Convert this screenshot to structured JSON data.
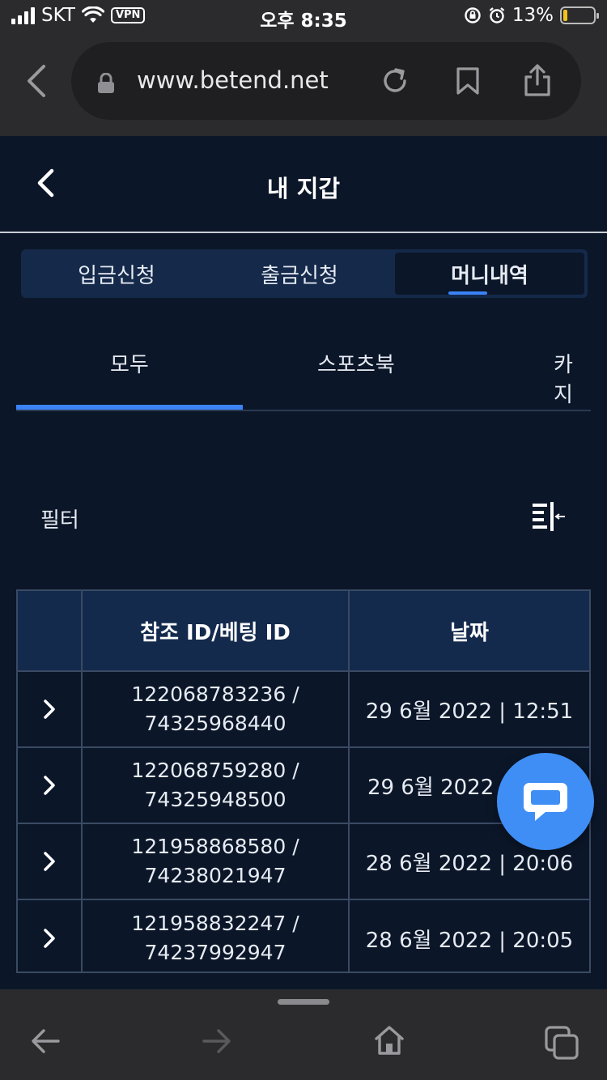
{
  "status_bar": {
    "carrier": "SKT",
    "vpn": "VPN",
    "time": "오후 8:35",
    "battery": "13%",
    "battery_level": 0.13
  },
  "browser": {
    "url": "www.betend.net"
  },
  "header": {
    "title": "내 지갑"
  },
  "segment_tabs": [
    "입금신청",
    "출금신청",
    "머니내역"
  ],
  "segment_active_index": 2,
  "sub_tabs": [
    "모두",
    "스포츠북",
    "카지"
  ],
  "sub_tab_active_index": 0,
  "filter": {
    "label": "필터"
  },
  "table": {
    "headers": [
      "",
      "참조 ID/베팅 ID",
      "날짜"
    ],
    "rows": [
      {
        "ref_id": "122068783236 /",
        "bet_id": "74325968440",
        "date": "29 6월 2022 | 12:51"
      },
      {
        "ref_id": "122068759280 /",
        "bet_id": "74325948500",
        "date": "29 6월 2022 |"
      },
      {
        "ref_id": "121958868580 /",
        "bet_id": "74238021947",
        "date": "28 6월 2022 | 20:06"
      },
      {
        "ref_id": "121958832247 /",
        "bet_id": "74237992947",
        "date": "28 6월 2022 | 20:05"
      }
    ]
  },
  "colors": {
    "background": "#0b1628",
    "accent": "#3b82f6",
    "header_row": "#132a4d",
    "chat_button": "#3f8ef5"
  }
}
